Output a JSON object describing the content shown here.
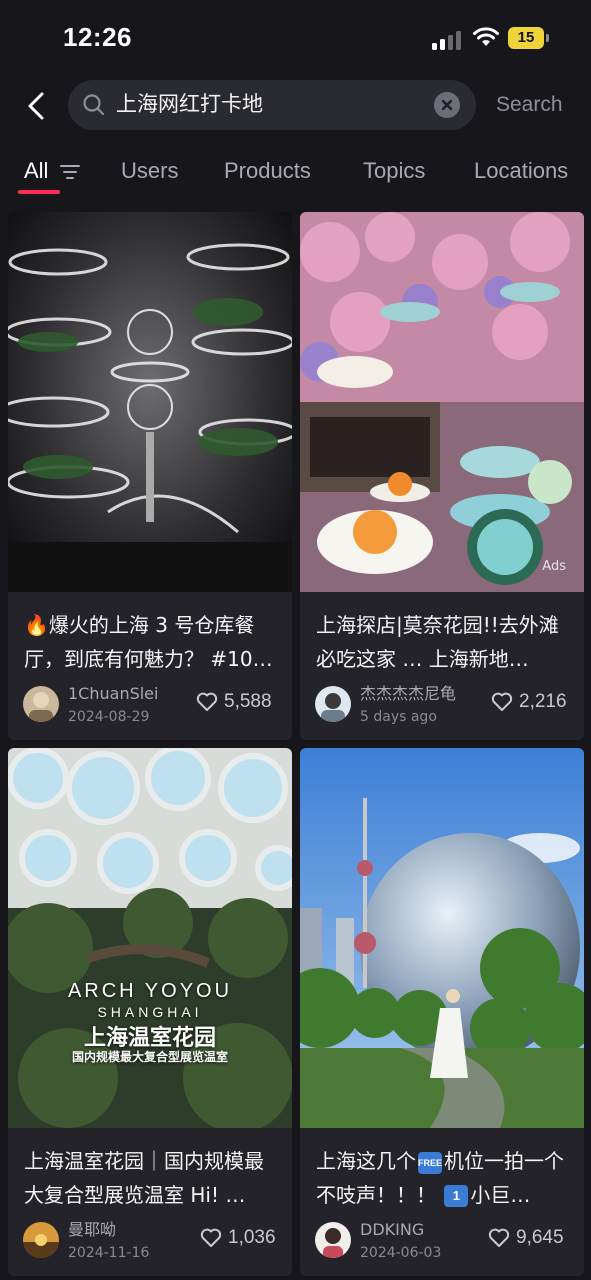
{
  "status_bar": {
    "time": "12:26",
    "battery": "15"
  },
  "search": {
    "query": "上海网红打卡地",
    "button_label": "Search"
  },
  "tabs": [
    {
      "label": "All",
      "active": true
    },
    {
      "label": "Users"
    },
    {
      "label": "Products"
    },
    {
      "label": "Topics"
    },
    {
      "label": "Locations"
    }
  ],
  "results": [
    {
      "title": "🔥爆火的上海 3 号仓库餐厅，到底有何魅力？ #10…",
      "author": "1ChuanSlei",
      "date": "2024-08-29",
      "likes": "5,588"
    },
    {
      "title": "上海探店|莫奈花园!!去外滩必吃这家 … 上海新地…",
      "author": "杰杰杰杰尼龟",
      "date": "5 days ago",
      "likes": "2,216",
      "badge": "Ads"
    },
    {
      "title": "上海温室花园｜国内规模最大复合型展览温室 Hi! …",
      "author": "曼耶呦",
      "date": "2024-11-16",
      "likes": "1,036",
      "overlay": {
        "line1": "ARCH YOYOU",
        "line2": "SHANGHAI",
        "line3": "上海温室花园",
        "line4": "国内规模最大复合型展览温室"
      }
    },
    {
      "title_part1": "上海这几个",
      "title_emoji1": "FREE",
      "title_part2": "机位一拍一个不吱声！！！",
      "title_emoji2": "1",
      "title_part3": "小巨…",
      "author": "DDKING",
      "date": "2024-06-03",
      "likes": "9,645"
    }
  ],
  "colors": {
    "background": "#16161b",
    "card": "#232329",
    "accent_underline": "#ff2d55",
    "battery": "#f0d53a"
  },
  "icons": [
    "signal-icon",
    "wifi-icon",
    "back-arrow-icon",
    "search-icon",
    "clear-icon",
    "filter-icon",
    "heart-icon"
  ]
}
